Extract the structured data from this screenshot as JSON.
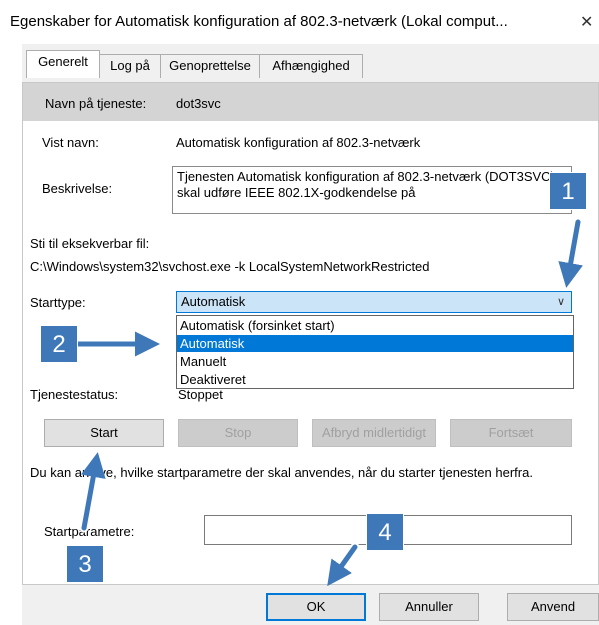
{
  "window": {
    "title": "Egenskaber for Automatisk konfiguration af 802.3-netværk (Lokal comput...",
    "close_label": "✕"
  },
  "tabs": [
    {
      "label": "Generelt",
      "active": true
    },
    {
      "label": "Log på"
    },
    {
      "label": "Genoprettelse"
    },
    {
      "label": "Afhængighed"
    }
  ],
  "general": {
    "service_name_label": "Navn på tjeneste:",
    "service_name_value": "dot3svc",
    "display_name_label": "Vist navn:",
    "display_name_value": "Automatisk konfiguration af 802.3-netværk",
    "description_label": "Beskrivelse:",
    "description_value": "Tjenesten Automatisk konfiguration af 802.3-netværk (DOT3SVC) skal udføre IEEE 802.1X-godkendelse på",
    "path_label": "Sti til eksekverbar fil:",
    "path_value": "C:\\Windows\\system32\\svchost.exe -k LocalSystemNetworkRestricted",
    "startup_type_label": "Starttype:",
    "startup_type_value": "Automatisk",
    "startup_options": [
      "Automatisk (forsinket start)",
      "Automatisk",
      "Manuelt",
      "Deaktiveret"
    ],
    "status_label": "Tjenestestatus:",
    "status_value": "Stoppet",
    "buttons": {
      "start": "Start",
      "stop": "Stop",
      "pause": "Afbryd midlertidigt",
      "resume": "Fortsæt"
    },
    "hint": "Du kan angive, hvilke startparametre der skal anvendes, når du starter tjenesten herfra.",
    "params_label": "Startparametre:",
    "params_value": ""
  },
  "footer": {
    "ok": "OK",
    "cancel": "Annuller",
    "apply": "Anvend"
  },
  "annotations": [
    "1",
    "2",
    "3",
    "4"
  ],
  "colors": {
    "badge": "#3e78b8",
    "selection": "#0078d7",
    "combo_bg": "#cce4f7"
  }
}
